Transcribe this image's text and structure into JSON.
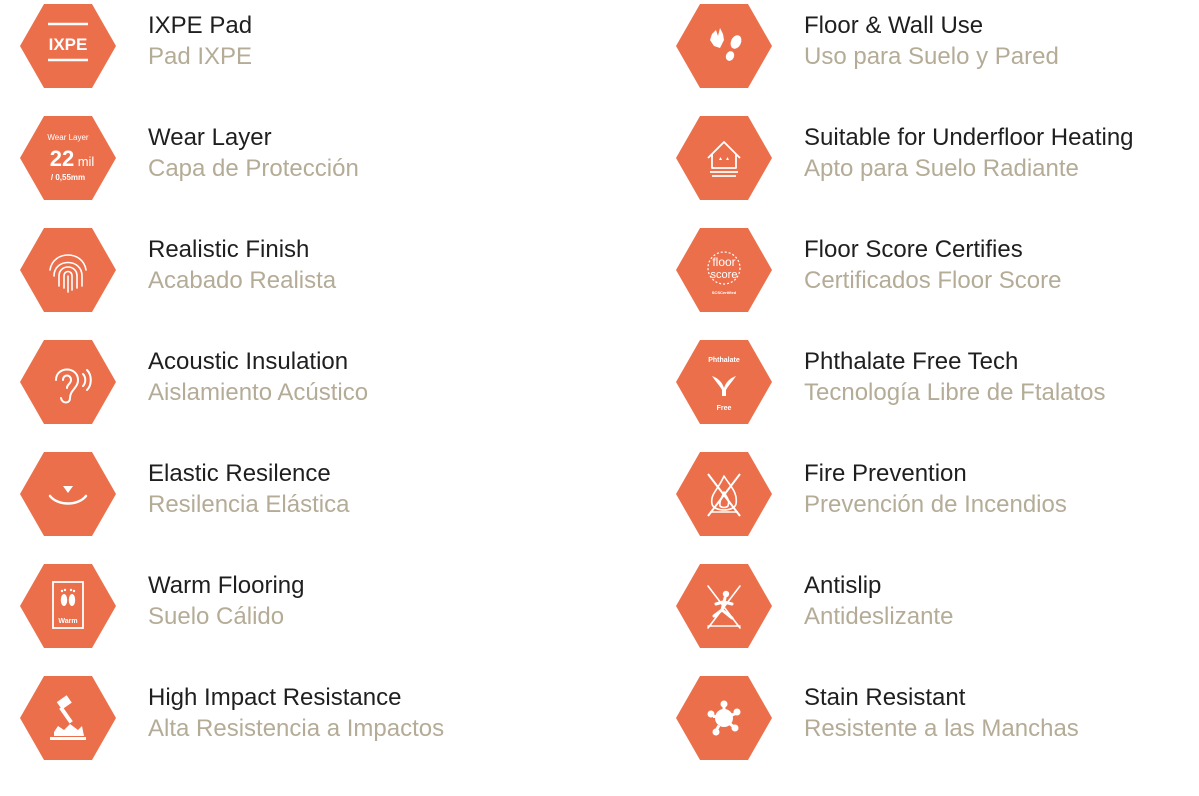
{
  "colors": {
    "hex_fill": "#ec6f4c",
    "icon_stroke": "#ffffff",
    "title_text": "#1f1f1f",
    "subtitle_text": "#b4ac97"
  },
  "left": [
    {
      "icon": "ixpe-pad-icon",
      "en": "IXPE Pad",
      "es": "Pad IXPE",
      "badge": "IXPE"
    },
    {
      "icon": "wear-layer-icon",
      "en": "Wear Layer",
      "es": "Capa de Protección",
      "badge_top": "Wear Layer",
      "badge_value": "22",
      "badge_unit": "mil",
      "badge_sub": "/ 0,55mm"
    },
    {
      "icon": "fingerprint-icon",
      "en": "Realistic Finish",
      "es": "Acabado Realista"
    },
    {
      "icon": "ear-sound-icon",
      "en": "Acoustic Insulation",
      "es": "Aislamiento Acústico"
    },
    {
      "icon": "elastic-curve-icon",
      "en": "Elastic Resilence",
      "es": "Resilencia Elástica"
    },
    {
      "icon": "warm-feet-icon",
      "en": "Warm Flooring",
      "es": "Suelo Cálido",
      "badge": "Warm"
    },
    {
      "icon": "impact-hammer-icon",
      "en": "High Impact Resistance",
      "es": "Alta Resistencia a Impactos"
    }
  ],
  "right": [
    {
      "icon": "hand-foot-icon",
      "en": "Floor & Wall Use",
      "es": "Uso para Suelo y Pared"
    },
    {
      "icon": "house-heating-icon",
      "en": "Suitable for Underfloor Heating",
      "es": "Apto para Suelo Radiante"
    },
    {
      "icon": "floorscore-icon",
      "en": "Floor Score Certifies",
      "es": "Certificados Floor Score",
      "badge_top": "floor",
      "badge_value": "score",
      "badge_sub": "SCSCertified"
    },
    {
      "icon": "phthalate-bird-icon",
      "en": "Phthalate Free Tech",
      "es": "Tecnología Libre de Ftalatos",
      "badge_top": "Phthalate",
      "badge_sub": "Free"
    },
    {
      "icon": "no-fire-icon",
      "en": "Fire Prevention",
      "es": "Prevención de Incendios"
    },
    {
      "icon": "antislip-person-icon",
      "en": "Antislip",
      "es": "Antideslizante"
    },
    {
      "icon": "stain-splash-icon",
      "en": "Stain Resistant",
      "es": "Resistente a las Manchas"
    }
  ]
}
